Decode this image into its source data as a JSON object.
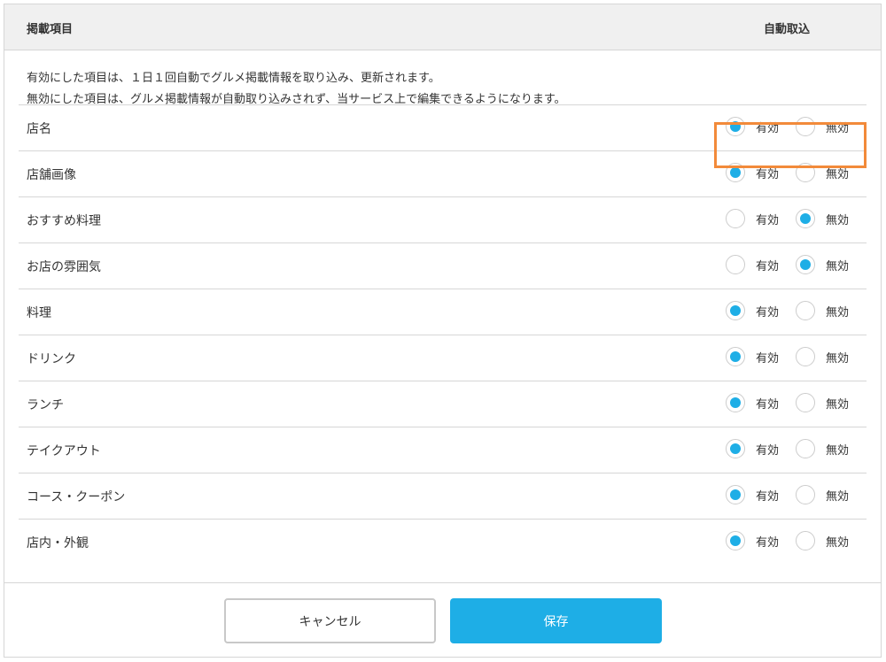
{
  "header": {
    "item_col": "掲載項目",
    "auto_col": "自動取込"
  },
  "description": [
    "有効にした項目は、１日１回自動でグルメ掲載情報を取り込み、更新されます。",
    "無効にした項目は、グルメ掲載情報が自動取り込みされず、当サービス上で編集できるようになります。"
  ],
  "options": {
    "on": "有効",
    "off": "無効"
  },
  "items": [
    {
      "label": "店名",
      "enabled": true
    },
    {
      "label": "店舗画像",
      "enabled": true
    },
    {
      "label": "おすすめ料理",
      "enabled": false
    },
    {
      "label": "お店の雰囲気",
      "enabled": false
    },
    {
      "label": "料理",
      "enabled": true
    },
    {
      "label": "ドリンク",
      "enabled": true
    },
    {
      "label": "ランチ",
      "enabled": true
    },
    {
      "label": "テイクアウト",
      "enabled": true
    },
    {
      "label": "コース・クーポン",
      "enabled": true
    },
    {
      "label": "店内・外観",
      "enabled": true
    }
  ],
  "footer": {
    "cancel_label": "キャンセル",
    "save_label": "保存"
  },
  "colors": {
    "accent": "#1eaee6",
    "highlight": "#f28a3a"
  }
}
